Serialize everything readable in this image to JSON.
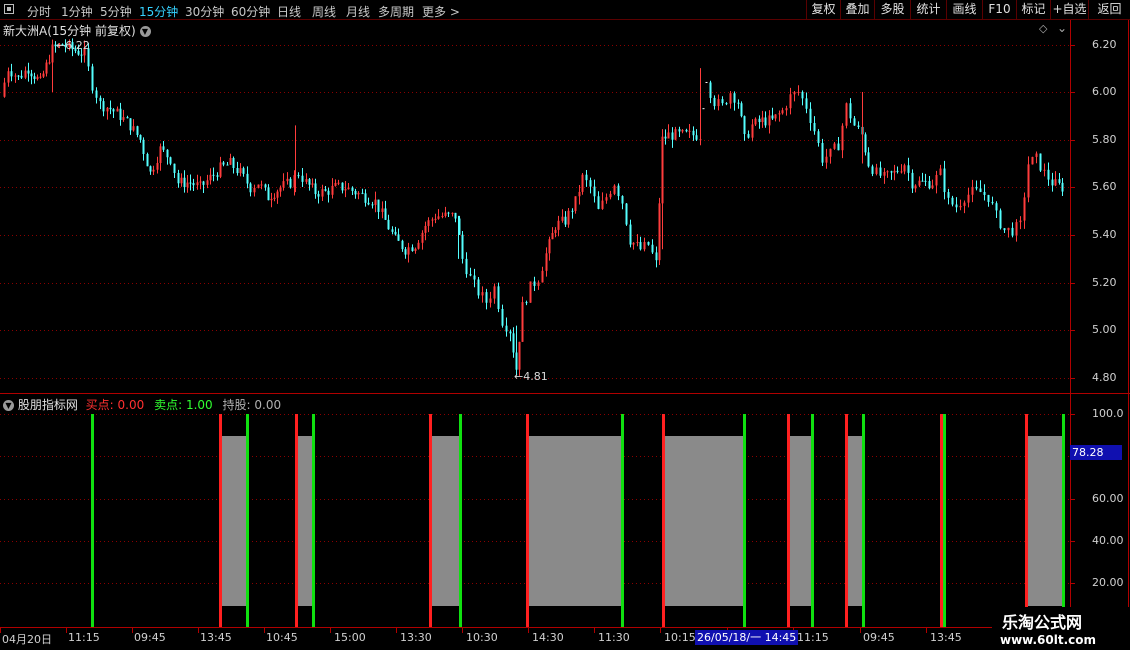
{
  "toolbar": {
    "timeframes": [
      "分时",
      "1分钟",
      "5分钟",
      "15分钟",
      "30分钟",
      "60分钟",
      "日线",
      "周线",
      "月线",
      "多周期",
      "更多 >"
    ],
    "active_timeframe": "15分钟",
    "right_buttons": [
      "复权",
      "叠加",
      "多股",
      "统计",
      "画线",
      "F10",
      "标记",
      "+自选",
      "返回"
    ]
  },
  "main_chart": {
    "title": "新大洲A(15分钟 前复权)",
    "high_label": "6.22",
    "low_label": "4.81",
    "y_ticks": [
      "6.20",
      "6.00",
      "5.80",
      "5.60",
      "5.40",
      "5.20",
      "5.00",
      "4.80"
    ]
  },
  "indicator": {
    "name": "股朋指标网",
    "buy_label": "买点:",
    "buy_value": "0.00",
    "sell_label": "卖点:",
    "sell_value": "1.00",
    "hold_label": "持股:",
    "hold_value": "0.00",
    "current_value": "78.28",
    "y_ticks": [
      "100.0",
      "60.00",
      "40.00",
      "20.00"
    ]
  },
  "x_axis": {
    "labels": [
      "04月20日",
      "11:15",
      "09:45",
      "13:45",
      "10:45",
      "15:00",
      "13:30",
      "10:30",
      "14:30",
      "11:30",
      "10:15",
      "11:15",
      "09:45",
      "13:45"
    ],
    "cursor_label": "26/05/18/一 14:45"
  },
  "watermark": {
    "title": "乐淘公式网",
    "url": "www.60lt.com"
  },
  "colors": {
    "up": "#ff3c3c",
    "down": "#54ffff",
    "buy": "#ff2020",
    "sell": "#10e010",
    "hold_fill": "#8a8a8a",
    "grid": "#8a0000",
    "axis": "#b00000"
  }
}
